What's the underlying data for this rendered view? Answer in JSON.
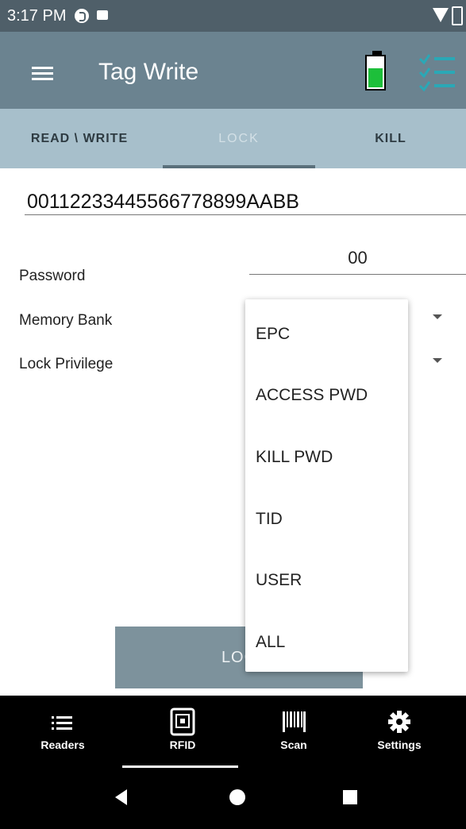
{
  "status_bar": {
    "time": "3:17 PM"
  },
  "app_bar": {
    "title": "Tag Write"
  },
  "tabs": [
    {
      "label": "READ \\ WRITE"
    },
    {
      "label": "LOCK"
    },
    {
      "label": "KILL"
    }
  ],
  "tag": {
    "id": "00112233445566778899AABB"
  },
  "form": {
    "password_label": "Password",
    "password_value": "00",
    "memory_bank_label": "Memory Bank",
    "lock_privilege_label": "Lock Privilege"
  },
  "lock_button": {
    "label": "LOC"
  },
  "dropdown": {
    "options": [
      "EPC",
      "ACCESS PWD",
      "KILL PWD",
      "TID",
      "USER",
      "ALL"
    ]
  },
  "bottom_nav": [
    {
      "label": "Readers",
      "icon": "list-icon"
    },
    {
      "label": "RFID",
      "icon": "rfid-icon"
    },
    {
      "label": "Scan",
      "icon": "barcode-icon"
    },
    {
      "label": "Settings",
      "icon": "gear-icon"
    }
  ],
  "colors": {
    "status_bar": "#4f5f69",
    "app_bar": "#6b8390",
    "tab_bar": "#a7bfcb",
    "battery_fill": "#1dbf3a",
    "checklist_icon": "#2aa8b6"
  }
}
